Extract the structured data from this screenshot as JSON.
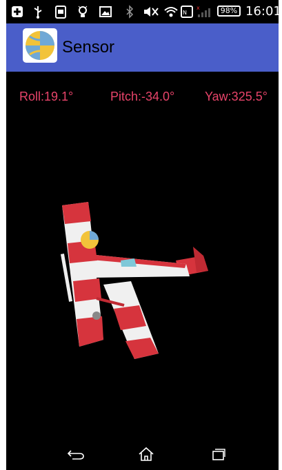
{
  "status_bar": {
    "icons": [
      "plus-icon",
      "usb-icon",
      "clipboard-icon",
      "lightbulb-icon",
      "image-icon",
      "bluetooth-icon",
      "mute-icon",
      "wifi-icon",
      "nfc-icon",
      "signal-icon"
    ],
    "battery": "98%",
    "time": "16:01"
  },
  "app_bar": {
    "title": "Sensor",
    "color": "#4a5ec9"
  },
  "readouts": {
    "roll": "Roll:19.1°",
    "pitch": "Pitch:-34.0°",
    "yaw": "Yaw:325.5°",
    "color": "#e8446a"
  },
  "model": {
    "description_icon": "biplane-model",
    "colors": [
      "#d6343d",
      "#f0f0f0",
      "#7ec8d8"
    ]
  },
  "nav_bar": {
    "buttons": [
      "back-icon",
      "home-icon",
      "recents-icon"
    ]
  }
}
